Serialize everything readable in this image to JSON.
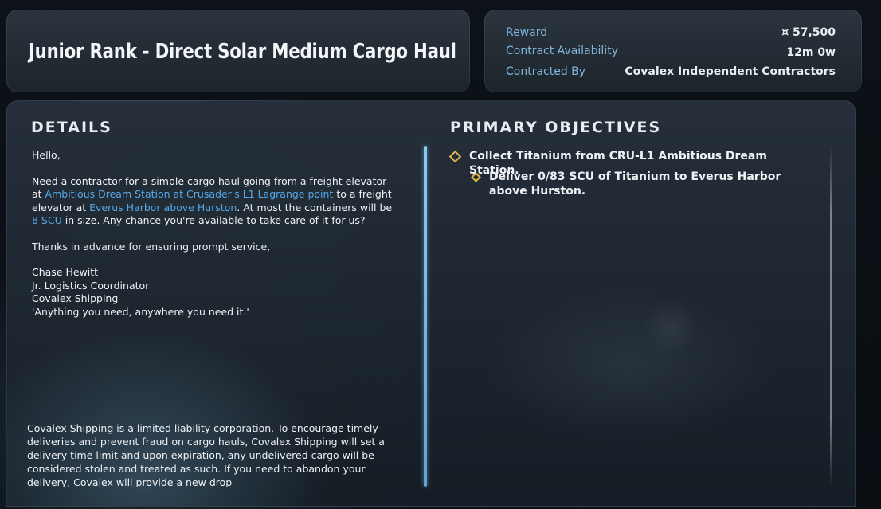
{
  "header": {
    "title": "Junior Rank - Direct Solar Medium Cargo Haul"
  },
  "contract_info": {
    "reward_label": "Reward",
    "reward_value": "¤ 57,500",
    "availability_label": "Contract Availability",
    "availability_value": "12m 0w",
    "contracted_by_label": "Contracted By",
    "contracted_by_value": "Covalex Independent Contractors"
  },
  "details": {
    "heading": "DETAILS",
    "greeting": "Hello,",
    "p1_a": "Need a contractor for a simple cargo haul going from a freight elevator at ",
    "p1_link1": "Ambitious Dream Station at Crusader's L1 Lagrange point",
    "p1_b": " to a freight elevator at ",
    "p1_link2": "Everus Harbor above Hurston",
    "p1_c": ". At most the containers will be ",
    "p1_link3": "8 SCU",
    "p1_d": " in size. Any chance you're available to take care of it for us?",
    "p2": "Thanks in advance for ensuring prompt service,",
    "sig_name": "Chase Hewitt",
    "sig_title": "Jr. Logistics Coordinator",
    "sig_company": "Covalex Shipping",
    "sig_motto": "'Anything you need, anywhere you need it.'",
    "legal": "Covalex Shipping is a limited liability corporation. To encourage timely deliveries and prevent fraud on cargo hauls, Covalex Shipping will set a delivery time limit and upon expiration, any undelivered cargo will be considered stolen and treated as such. If you need to abandon your delivery, Covalex will provide a new drop"
  },
  "objectives": {
    "heading": "PRIMARY OBJECTIVES",
    "items": [
      {
        "text": "Collect Titanium from CRU-L1 Ambitious Dream Station."
      },
      {
        "text": "Deliver 0/83 SCU of Titanium to Everus Harbor above Hurston."
      }
    ]
  },
  "colors": {
    "accent_link": "#55a7e8",
    "label_blue": "#7fb6dd",
    "objective_diamond": "#e0b94a"
  }
}
